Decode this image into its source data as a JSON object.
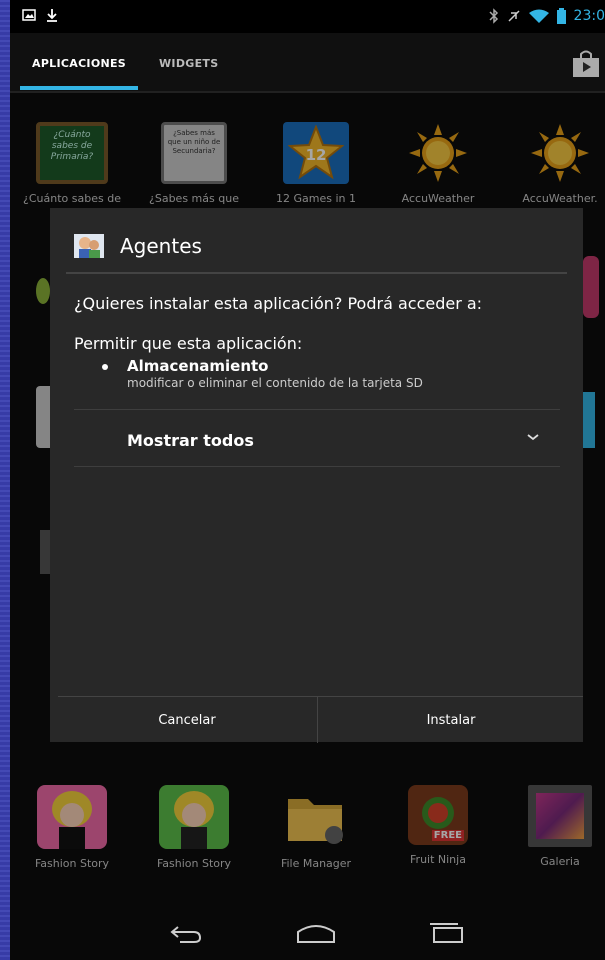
{
  "status_bar": {
    "time": "23:0"
  },
  "tabs": {
    "apps": "APLICACIONES",
    "widgets": "WIDGETS"
  },
  "top_apps": [
    {
      "label": "¿Cuánto sabes de",
      "icon": "chalkboard-icon",
      "icon_text": "¿Cuánto sabes de Primaria?"
    },
    {
      "label": "¿Sabes más que",
      "icon": "paper-icon",
      "icon_text": "¿Sabes más que un niño de Secundaria?"
    },
    {
      "label": "12 Games in 1",
      "icon": "star-icon",
      "icon_text": "12"
    },
    {
      "label": "AccuWeather",
      "icon": "sun-icon"
    },
    {
      "label": "AccuWeather.",
      "icon": "sun-icon"
    }
  ],
  "dialog": {
    "title": "Agentes",
    "question": "¿Quieres instalar esta aplicación? Podrá acceder a:",
    "permit_intro": "Permitir que esta aplicación:",
    "permission": {
      "title": "Almacenamiento",
      "description": "modificar o eliminar el contenido de la tarjeta SD"
    },
    "show_all": "Mostrar todos",
    "cancel": "Cancelar",
    "install": "Instalar"
  },
  "bottom_apps": [
    {
      "label": "Fashion Story",
      "icon": "fashion-story-icon"
    },
    {
      "label": "Fashion Story",
      "icon": "fashion-story-icon"
    },
    {
      "label": "File Manager",
      "icon": "folder-icon"
    },
    {
      "label": "Fruit Ninja",
      "icon": "fruit-ninja-icon",
      "icon_text": "FREE"
    },
    {
      "label": "Galeria",
      "icon": "gallery-icon"
    }
  ],
  "colors": {
    "accent": "#33b5e5",
    "dialog_bg": "#282828"
  }
}
